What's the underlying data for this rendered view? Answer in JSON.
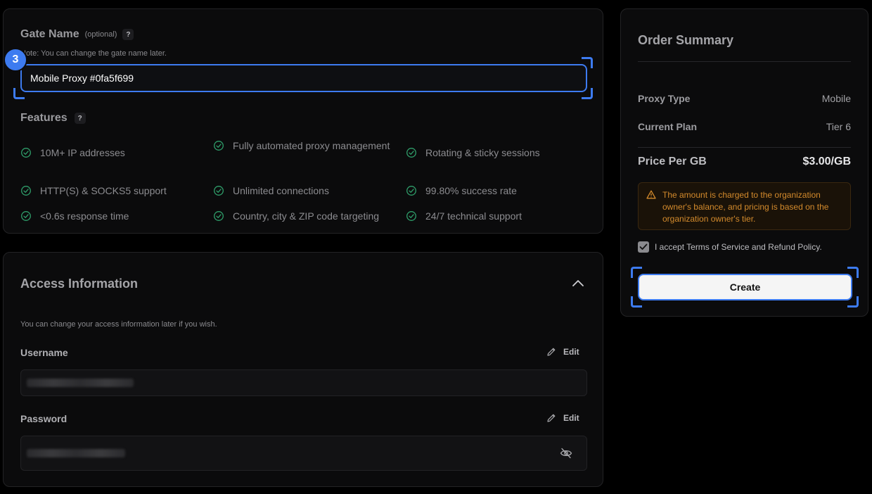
{
  "gate": {
    "title": "Gate Name",
    "optional": "(optional)",
    "help": "?",
    "note": "Note: You can change the gate name later.",
    "input_value": "Mobile Proxy #0fa5f699",
    "step_badge": "3"
  },
  "features": {
    "title": "Features",
    "help": "?",
    "items": [
      "10M+ IP addresses",
      "Fully automated proxy management",
      "Rotating & sticky sessions",
      "HTTP(S) & SOCKS5 support",
      "Unlimited connections",
      "99.80% success rate",
      "<0.6s response time",
      "Country, city & ZIP code targeting",
      "24/7 technical support"
    ]
  },
  "access": {
    "title": "Access Information",
    "note": "You can change your access information later if you wish.",
    "username_label": "Username",
    "password_label": "Password",
    "edit_label": "Edit"
  },
  "summary": {
    "title": "Order Summary",
    "proxy_type_label": "Proxy Type",
    "proxy_type_value": "Mobile",
    "plan_label": "Current Plan",
    "plan_value": "Tier 6",
    "price_label": "Price Per GB",
    "price_value": "$3.00/GB",
    "warning": "The amount is charged to the organization owner's balance, and pricing is based on the organization owner's tier.",
    "terms": "I accept Terms of Service and Refund Policy.",
    "create_label": "Create"
  },
  "colors": {
    "accent": "#3d7bf0",
    "check": "#2f9e6a",
    "warning": "#d38a2c"
  },
  "icons": {
    "feature": "check-circle-icon",
    "edit": "pencil-icon",
    "reveal": "eye-off-icon",
    "collapse": "chevron-up-icon",
    "warning": "warning-triangle-icon"
  }
}
